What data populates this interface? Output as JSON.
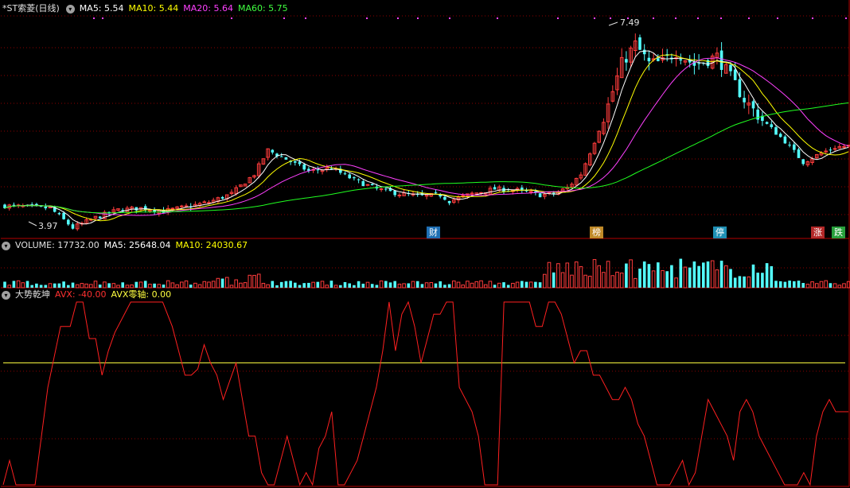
{
  "main": {
    "stock_name": "*ST索菱(日线)",
    "ma5": "MA5: 5.54",
    "ma10": "MA10: 5.44",
    "ma20": "MA20: 5.64",
    "ma60": "MA60: 5.75",
    "max_price_label": "7.49",
    "min_price_label": "3.97",
    "event_tags": [
      {
        "label": "财",
        "color": "#1e6fb4"
      },
      {
        "label": "榜",
        "color": "#c08a28"
      },
      {
        "label": "停",
        "color": "#1e8fb4"
      },
      {
        "label": "涨",
        "color": "#b42828"
      },
      {
        "label": "跌",
        "color": "#28a03c"
      }
    ]
  },
  "volume": {
    "label": "VOLUME: 17732.00",
    "ma5": "MA5: 25648.04",
    "ma10": "MA10: 24030.67"
  },
  "indicator": {
    "name": "大势乾坤",
    "avx": "AVX: -40.00",
    "avx_zero": "AVX零轴: 0.00"
  },
  "colors": {
    "up": "#ff3c3c",
    "down": "#54ffff",
    "ma5": "#ffffff",
    "ma10": "#ffff00",
    "ma20": "#ff40ff",
    "ma60": "#20ff20",
    "grid": "#8b0000",
    "avx": "#ff2020",
    "zero_axis": "#ffff40"
  },
  "chart_data": {
    "type": "candlestick",
    "price_range": [
      3.9,
      7.6
    ],
    "close_keypoints": [
      [
        0,
        4.42
      ],
      [
        10,
        4.38
      ],
      [
        15,
        4.05
      ],
      [
        20,
        4.22
      ],
      [
        25,
        4.35
      ],
      [
        30,
        4.38
      ],
      [
        35,
        4.33
      ],
      [
        40,
        4.4
      ],
      [
        45,
        4.48
      ],
      [
        50,
        4.62
      ],
      [
        55,
        4.95
      ],
      [
        58,
        5.35
      ],
      [
        62,
        5.2
      ],
      [
        67,
        5.0
      ],
      [
        72,
        5.05
      ],
      [
        77,
        4.85
      ],
      [
        82,
        4.7
      ],
      [
        87,
        4.62
      ],
      [
        92,
        4.58
      ],
      [
        96,
        4.6
      ],
      [
        98,
        4.5
      ],
      [
        103,
        4.62
      ],
      [
        108,
        4.7
      ],
      [
        113,
        4.68
      ],
      [
        118,
        4.6
      ],
      [
        121,
        4.62
      ],
      [
        124,
        4.72
      ],
      [
        127,
        4.95
      ],
      [
        130,
        5.5
      ],
      [
        133,
        6.1
      ],
      [
        136,
        6.8
      ],
      [
        139,
        7.12
      ],
      [
        142,
        6.8
      ],
      [
        145,
        6.82
      ],
      [
        148,
        7.0
      ],
      [
        152,
        6.78
      ],
      [
        157,
        6.92
      ],
      [
        161,
        6.45
      ],
      [
        163,
        6.2
      ],
      [
        167,
        5.85
      ],
      [
        172,
        5.5
      ],
      [
        176,
        5.15
      ],
      [
        180,
        5.3
      ],
      [
        183,
        5.4
      ],
      [
        186,
        5.42
      ]
    ],
    "ma_lengths": [
      5,
      10,
      20,
      60
    ],
    "avx_keypoints": [
      [
        0,
        -100
      ],
      [
        2,
        -80
      ],
      [
        4,
        -100
      ],
      [
        10,
        -100
      ],
      [
        14,
        -20
      ],
      [
        18,
        30
      ],
      [
        21,
        30
      ],
      [
        23,
        50
      ],
      [
        25,
        50
      ],
      [
        27,
        20
      ],
      [
        29,
        20
      ],
      [
        31,
        -10
      ],
      [
        33,
        10
      ],
      [
        35,
        25
      ],
      [
        40,
        50
      ],
      [
        43,
        50
      ],
      [
        45,
        50
      ],
      [
        50,
        50
      ],
      [
        53,
        30
      ],
      [
        55,
        10
      ],
      [
        57,
        -10
      ],
      [
        59,
        -10
      ],
      [
        61,
        -5
      ],
      [
        63,
        15
      ],
      [
        65,
        0
      ],
      [
        67,
        -10
      ],
      [
        69,
        -30
      ],
      [
        71,
        -15
      ],
      [
        73,
        0
      ],
      [
        75,
        -30
      ],
      [
        77,
        -60
      ],
      [
        79,
        -60
      ],
      [
        81,
        -90
      ],
      [
        83,
        -100
      ],
      [
        85,
        -100
      ],
      [
        87,
        -80
      ],
      [
        89,
        -60
      ],
      [
        91,
        -80
      ],
      [
        93,
        -100
      ],
      [
        95,
        -90
      ],
      [
        97,
        -100
      ],
      [
        99,
        -70
      ],
      [
        101,
        -60
      ],
      [
        103,
        -40
      ],
      [
        105,
        -100
      ],
      [
        107,
        -100
      ],
      [
        109,
        -90
      ],
      [
        111,
        -80
      ],
      [
        113,
        -60
      ],
      [
        115,
        -40
      ],
      [
        117,
        -20
      ],
      [
        119,
        10
      ],
      [
        121,
        50
      ],
      [
        123,
        10
      ],
      [
        125,
        40
      ],
      [
        127,
        50
      ],
      [
        129,
        30
      ],
      [
        131,
        0
      ],
      [
        133,
        20
      ],
      [
        135,
        40
      ],
      [
        137,
        40
      ],
      [
        139,
        50
      ],
      [
        141,
        50
      ],
      [
        143,
        -20
      ],
      [
        145,
        -30
      ],
      [
        147,
        -40
      ],
      [
        149,
        -60
      ],
      [
        151,
        -100
      ],
      [
        153,
        -100
      ],
      [
        155,
        -100
      ],
      [
        157,
        50
      ],
      [
        159,
        50
      ],
      [
        161,
        50
      ],
      [
        163,
        50
      ],
      [
        165,
        50
      ],
      [
        167,
        30
      ],
      [
        169,
        30
      ],
      [
        171,
        50
      ],
      [
        173,
        50
      ],
      [
        175,
        40
      ],
      [
        177,
        20
      ],
      [
        179,
        0
      ],
      [
        181,
        10
      ],
      [
        183,
        10
      ],
      [
        185,
        -10
      ],
      [
        187,
        -10
      ],
      [
        189,
        -20
      ],
      [
        191,
        -30
      ],
      [
        193,
        -30
      ],
      [
        195,
        -20
      ],
      [
        197,
        -30
      ],
      [
        199,
        -50
      ],
      [
        201,
        -60
      ],
      [
        203,
        -80
      ],
      [
        205,
        -100
      ],
      [
        207,
        -100
      ],
      [
        209,
        -100
      ],
      [
        211,
        -90
      ],
      [
        213,
        -80
      ],
      [
        215,
        -100
      ],
      [
        217,
        -90
      ],
      [
        219,
        -60
      ],
      [
        221,
        -30
      ],
      [
        223,
        -40
      ],
      [
        225,
        -50
      ],
      [
        227,
        -60
      ],
      [
        229,
        -80
      ],
      [
        231,
        -40
      ],
      [
        233,
        -30
      ],
      [
        235,
        -40
      ],
      [
        237,
        -60
      ],
      [
        239,
        -70
      ],
      [
        241,
        -80
      ],
      [
        243,
        -90
      ],
      [
        245,
        -100
      ],
      [
        247,
        -100
      ],
      [
        249,
        -100
      ],
      [
        251,
        -90
      ],
      [
        253,
        -100
      ],
      [
        255,
        -60
      ],
      [
        257,
        -40
      ],
      [
        259,
        -30
      ],
      [
        261,
        -40
      ],
      [
        263,
        -40
      ],
      [
        265,
        -40
      ]
    ],
    "avx_range": [
      -100,
      50
    ],
    "avx_zero": 0
  }
}
